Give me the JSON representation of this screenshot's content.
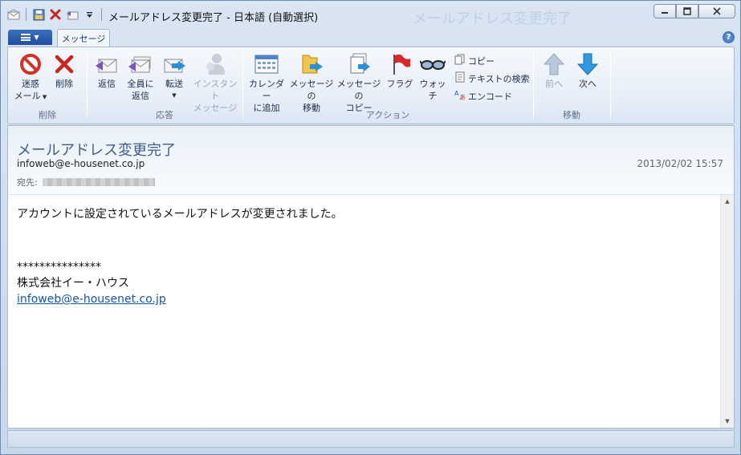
{
  "window": {
    "title": "メールアドレス変更完了 - 日本語 (自動選択)",
    "ghost_title": "メールアドレス変更完了"
  },
  "tabs": {
    "message": "メッセージ",
    "help": "?"
  },
  "ribbon": {
    "groups": {
      "delete": "削除",
      "respond": "応答",
      "actions": "アクション",
      "move": "移動"
    },
    "buttons": {
      "junk_line1": "迷惑",
      "junk_line2": "メール",
      "delete": "削除",
      "reply": "返信",
      "reply_all_line1": "全員に",
      "reply_all_line2": "返信",
      "forward": "転送",
      "im_line1": "インスタント",
      "im_line2": "メッセージ",
      "calendar_line1": "カレンダー",
      "calendar_line2": "に追加",
      "move_line1": "メッセージの",
      "move_line2": "移動",
      "copy_msg_line1": "メッセージの",
      "copy_msg_line2": "コピー",
      "flag": "フラグ",
      "watch": "ウォッチ",
      "copy": "コピー",
      "find_text": "テキストの検索",
      "encode": "エンコード",
      "previous": "前へ",
      "next": "次へ"
    }
  },
  "message": {
    "subject": "メールアドレス変更完了",
    "from": "infoweb@e-housenet.co.jp",
    "date": "2013/02/02 15:57",
    "to_label": "宛先:",
    "body_line1": "アカウントに設定されているメールアドレスが変更されました。",
    "stars": "***************",
    "company": "株式会社イー・ハウス",
    "link": "infoweb@e-housenet.co.jp"
  },
  "colors": {
    "accent": "#1f4f9e",
    "link": "#1155aa",
    "subject": "#3f5f8a"
  }
}
